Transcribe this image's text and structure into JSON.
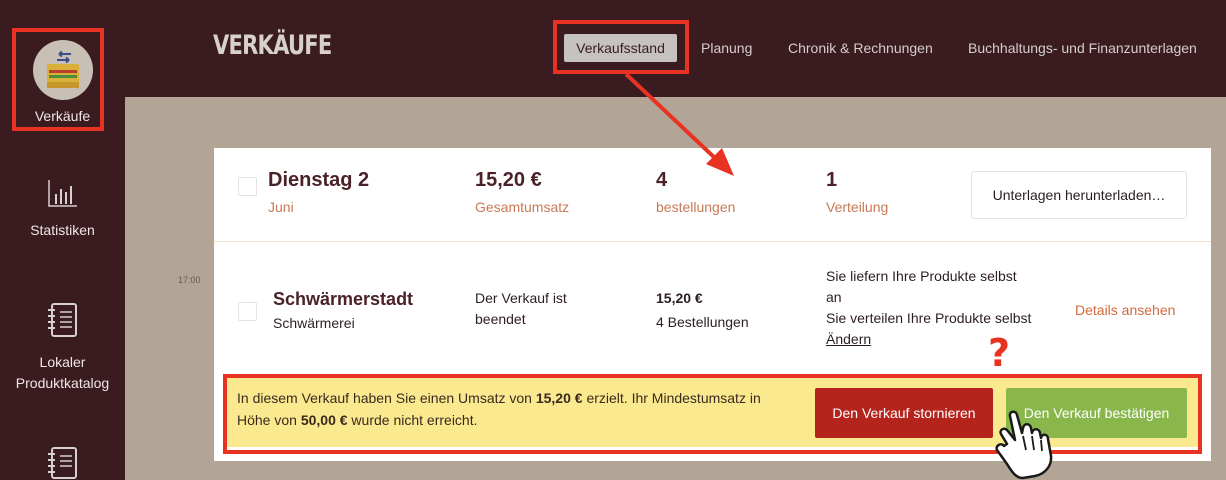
{
  "sidebar": {
    "items": [
      {
        "label": "Verkäufe",
        "icon": "sales-icon"
      },
      {
        "label": "Statistiken",
        "icon": "bar-chart-icon"
      },
      {
        "label": "Lokaler\nProduktkatalog",
        "label_line1": "Lokaler",
        "label_line2": "Produktkatalog",
        "icon": "notebook-icon"
      },
      {
        "label": "",
        "icon": "notebook-icon"
      }
    ]
  },
  "header": {
    "title": "VERKÄUFE",
    "nav": [
      {
        "label": "Verkaufsstand",
        "active": true
      },
      {
        "label": "Planung"
      },
      {
        "label": "Chronik & Rechnungen"
      },
      {
        "label": "Buchhaltungs- und Finanzunterlagen"
      }
    ]
  },
  "timestamp": "17:00",
  "summary": {
    "day": "Dienstag 2",
    "month": "Juni",
    "revenue": "15,20 €",
    "revenue_label": "Gesamtumsatz",
    "orders": "4",
    "orders_label": "bestellungen",
    "distribution": "1",
    "distribution_label": "Verteilung",
    "download_button": "Unterlagen herunterladen…"
  },
  "sale": {
    "location": "Schwärmerstadt",
    "host": "Schwärmerei",
    "status_line1": "Der Verkauf ist",
    "status_line2": "beendet",
    "amount": "15,20 €",
    "orders": "4 Bestellungen",
    "delivery_line1": "Sie liefern Ihre Produkte selbst",
    "delivery_line2": "an",
    "delivery_line3": "Sie verteilen Ihre Produkte selbst",
    "change_link": "Ändern",
    "details_link": "Details ansehen"
  },
  "warning": {
    "text_1": "In diesem Verkauf haben Sie einen Umsatz von ",
    "amount": "15,20 €",
    "text_2": " erzielt. Ihr Mindestumsatz in Höhe von ",
    "minimum": "50,00 €",
    "text_3": " wurde nicht erreicht.",
    "cancel_button": "Den Verkauf stornieren",
    "confirm_button": "Den Verkauf bestätigen"
  },
  "annotations": {
    "question_mark": "?"
  },
  "colors": {
    "sidebar_bg": "#3a1c20",
    "page_bg": "#b3a595",
    "accent_orange": "#c77a55",
    "highlight_red": "#e83222",
    "cancel_red": "#b4241d",
    "confirm_green": "#89b74b",
    "warning_yellow": "#fae98e"
  }
}
